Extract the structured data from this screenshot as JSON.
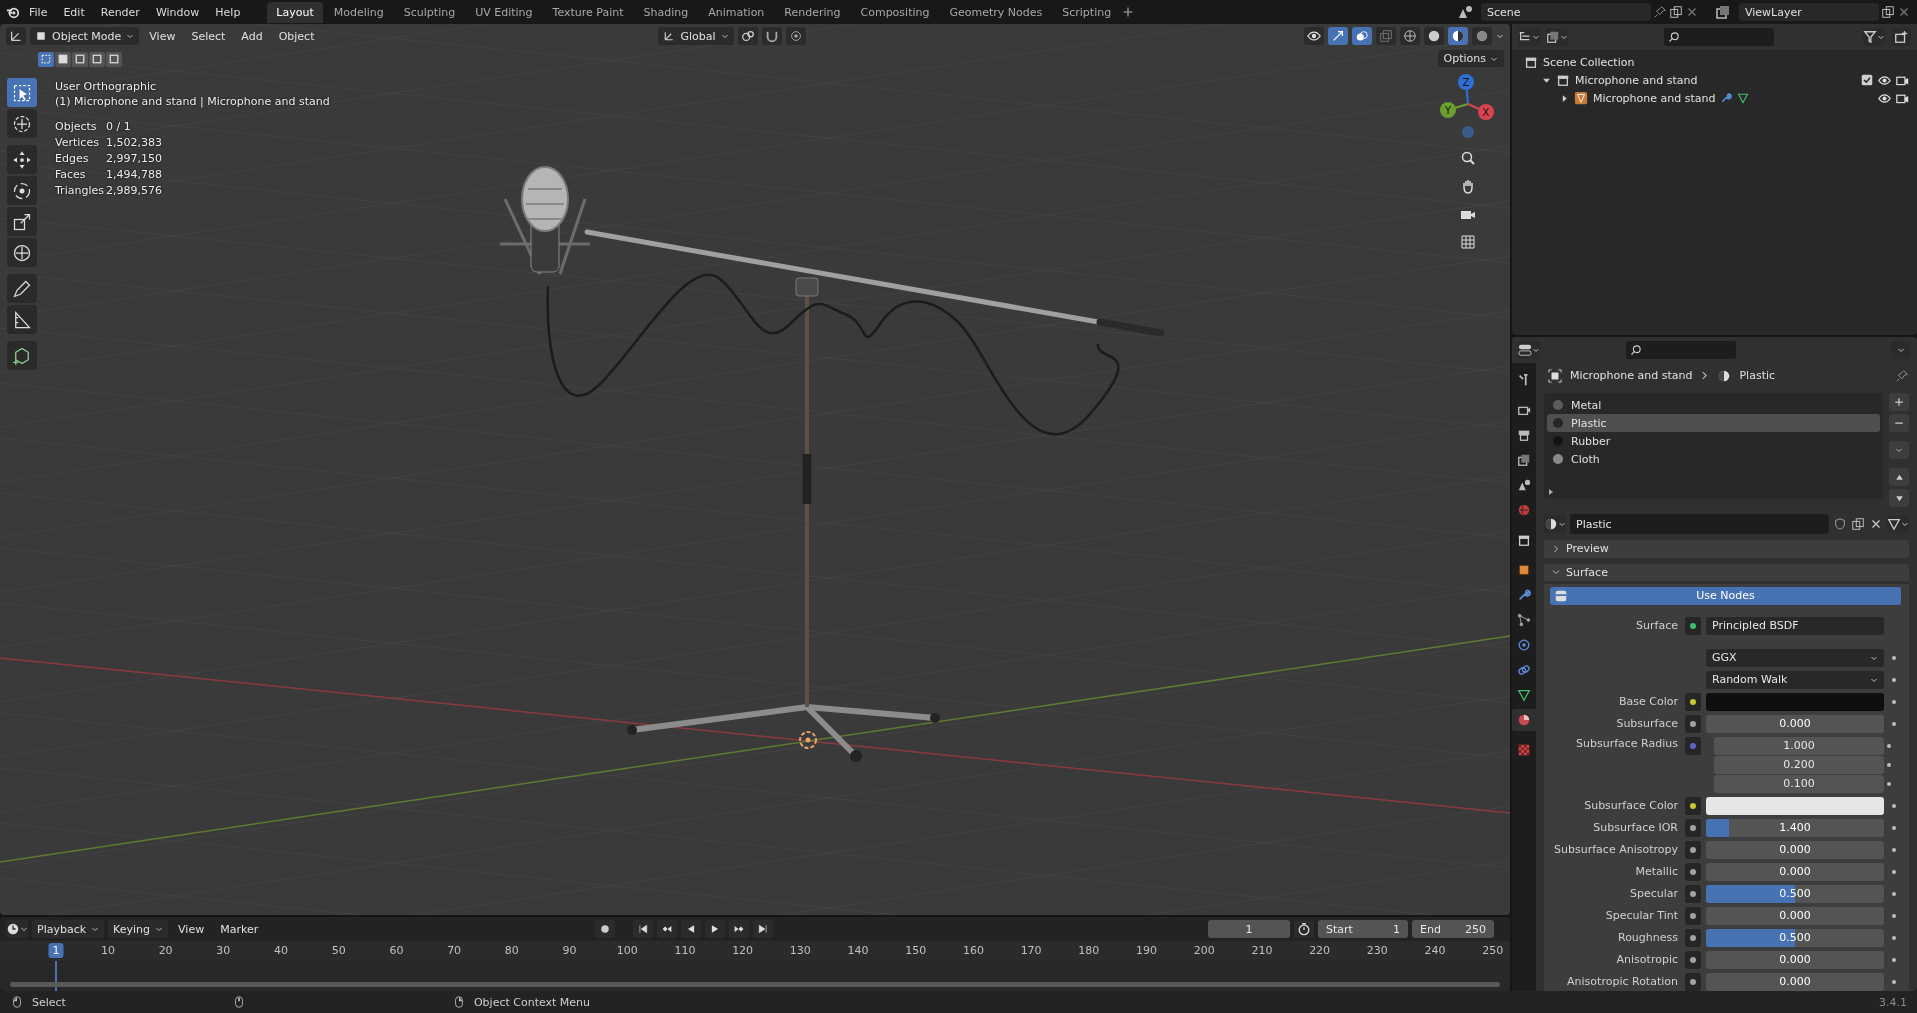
{
  "topbar": {
    "menus": [
      "File",
      "Edit",
      "Render",
      "Window",
      "Help"
    ],
    "workspaces": [
      {
        "label": "Layout",
        "selected": true
      },
      {
        "label": "Modeling",
        "selected": false
      },
      {
        "label": "Sculpting",
        "selected": false
      },
      {
        "label": "UV Editing",
        "selected": false
      },
      {
        "label": "Texture Paint",
        "selected": false
      },
      {
        "label": "Shading",
        "selected": false
      },
      {
        "label": "Animation",
        "selected": false
      },
      {
        "label": "Rendering",
        "selected": false
      },
      {
        "label": "Compositing",
        "selected": false
      },
      {
        "label": "Geometry Nodes",
        "selected": false
      },
      {
        "label": "Scripting",
        "selected": false
      }
    ],
    "scene": "Scene",
    "view_layer": "ViewLayer"
  },
  "viewport": {
    "mode": "Object Mode",
    "menus": [
      "View",
      "Select",
      "Add",
      "Object"
    ],
    "orientation": "Global",
    "options": "Options",
    "select_modes": [
      {
        "selected": true
      },
      {
        "selected": false
      },
      {
        "selected": false
      },
      {
        "selected": false
      },
      {
        "selected": false
      }
    ],
    "view_name": "User Orthographic",
    "object_name": "(1) Microphone and stand | Microphone and stand",
    "stats": [
      {
        "label": "Objects",
        "value": "0 / 1"
      },
      {
        "label": "Vertices",
        "value": "1,502,383"
      },
      {
        "label": "Edges",
        "value": "2,997,150"
      },
      {
        "label": "Faces",
        "value": "1,494,788"
      },
      {
        "label": "Triangles",
        "value": "2,989,576"
      }
    ],
    "tool_groups": [
      [
        {
          "kind": "select",
          "selected": true
        },
        {
          "kind": "cursor",
          "selected": false
        }
      ],
      [
        {
          "kind": "move",
          "selected": false
        },
        {
          "kind": "rotate",
          "selected": false
        },
        {
          "kind": "scale",
          "selected": false
        },
        {
          "kind": "transform",
          "selected": false
        }
      ],
      [
        {
          "kind": "annotate",
          "selected": false
        },
        {
          "kind": "measure",
          "selected": false
        }
      ],
      [
        {
          "kind": "add_cube",
          "selected": false
        }
      ]
    ],
    "gizmo": [
      {
        "label": "Z",
        "color": "#2f6fd6"
      },
      {
        "label": "Y",
        "color": "#6a9e2f"
      },
      {
        "label": "X",
        "color": "#d8434f"
      }
    ]
  },
  "outliner": {
    "root": "Scene Collection",
    "items": [
      {
        "label": "Microphone and stand",
        "kind": "collection",
        "expanded": true,
        "checked": true,
        "children": [
          {
            "label": "Microphone and stand",
            "kind": "object",
            "expanded": false
          }
        ]
      }
    ]
  },
  "properties": {
    "tab_groups": [
      [
        {
          "kind": "tool",
          "selected": false
        }
      ],
      [
        {
          "kind": "render",
          "selected": false
        },
        {
          "kind": "output",
          "selected": false
        },
        {
          "kind": "view_layer",
          "selected": false
        },
        {
          "kind": "scene",
          "selected": false
        },
        {
          "kind": "world",
          "selected": false
        }
      ],
      [
        {
          "kind": "collection",
          "selected": false
        }
      ],
      [
        {
          "kind": "object",
          "selected": false
        },
        {
          "kind": "modifiers",
          "selected": false
        },
        {
          "kind": "particles",
          "selected": false
        },
        {
          "kind": "physics",
          "selected": false
        },
        {
          "kind": "constraints",
          "selected": false
        },
        {
          "kind": "data",
          "selected": false
        },
        {
          "kind": "material",
          "selected": true
        }
      ],
      [
        {
          "kind": "texture",
          "selected": false
        }
      ]
    ],
    "breadcrumb": {
      "object": "Microphone and stand",
      "material": "Plastic"
    },
    "slots": [
      {
        "name": "Metal",
        "selected": false,
        "color": "#5c5c5c"
      },
      {
        "name": "Plastic",
        "selected": true,
        "color": "#262626"
      },
      {
        "name": "Rubber",
        "selected": false,
        "color": "#141414"
      },
      {
        "name": "Cloth",
        "selected": false,
        "color": "#8a8a8a"
      }
    ],
    "material": "Plastic",
    "panels": [
      {
        "label": "Preview",
        "expanded": false
      },
      {
        "label": "Surface",
        "expanded": true
      }
    ],
    "use_nodes": "Use Nodes",
    "surface": {
      "label": "Surface",
      "value": "Principled BSDF"
    },
    "fields": [
      {
        "kind": "dropdown",
        "value": "GGX"
      },
      {
        "kind": "dropdown",
        "value": "Random Walk"
      },
      {
        "kind": "color",
        "label": "Base Color",
        "color": "#0f0f0f"
      },
      {
        "kind": "number",
        "label": "Subsurface",
        "value": "0.000"
      },
      {
        "kind": "vector",
        "label": "Subsurface Radius",
        "values": [
          "1.000",
          "0.200",
          "0.100"
        ]
      },
      {
        "kind": "color",
        "label": "Subsurface Color",
        "color": "#e6e6e6"
      },
      {
        "kind": "number",
        "label": "Subsurface IOR",
        "value": "1.400",
        "level": 0.13
      },
      {
        "kind": "number",
        "label": "Subsurface Anisotropy",
        "value": "0.000"
      },
      {
        "kind": "number",
        "label": "Metallic",
        "value": "0.000"
      },
      {
        "kind": "number",
        "label": "Specular",
        "value": "0.500",
        "level": 0.5
      },
      {
        "kind": "number",
        "label": "Specular Tint",
        "value": "0.000"
      },
      {
        "kind": "number",
        "label": "Roughness",
        "value": "0.500",
        "level": 0.5
      },
      {
        "kind": "number",
        "label": "Anisotropic",
        "value": "0.000"
      },
      {
        "kind": "number",
        "label": "Anisotropic Rotation",
        "value": "0.000"
      }
    ]
  },
  "timeline": {
    "menus": [
      {
        "label": "Playback",
        "dropdown": true
      },
      {
        "label": "Keying",
        "dropdown": true
      },
      {
        "label": "View",
        "dropdown": false
      },
      {
        "label": "Marker",
        "dropdown": false
      }
    ],
    "frame": "1",
    "start_label": "Start",
    "start": "1",
    "end_label": "End",
    "end": "250",
    "current": "1",
    "ticks": [
      "10",
      "20",
      "30",
      "40",
      "50",
      "60",
      "70",
      "80",
      "90",
      "100",
      "110",
      "120",
      "130",
      "140",
      "150",
      "160",
      "170",
      "180",
      "190",
      "200",
      "210",
      "220",
      "230",
      "240",
      "250"
    ]
  },
  "status": {
    "items": [
      "Select",
      "Object Context Menu"
    ],
    "version": "3.4.1"
  }
}
